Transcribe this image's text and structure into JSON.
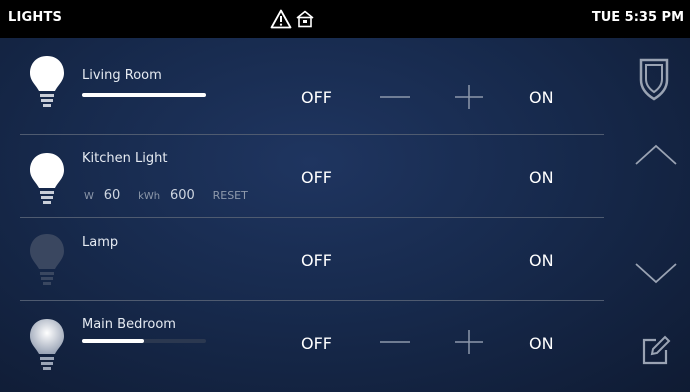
{
  "topbar": {
    "title": "LIGHTS",
    "time": "TUE 5:35 PM",
    "alert_icon": "warning-icon",
    "home_icon": "home-alert-icon"
  },
  "rows": [
    {
      "name": "Living Room",
      "off_label": "OFF",
      "on_label": "ON",
      "bulb": "bright",
      "level": 1.0,
      "has_dimmer": true
    },
    {
      "name": "Kitchen Light",
      "off_label": "OFF",
      "on_label": "ON",
      "bulb": "bright",
      "energy": {
        "w_label": "W",
        "w_value": "60",
        "kwh_label": "kWh",
        "kwh_value": "600",
        "reset_label": "RESET"
      }
    },
    {
      "name": "Lamp",
      "off_label": "OFF",
      "on_label": "ON",
      "bulb": "off"
    },
    {
      "name": "Main Bedroom",
      "off_label": "OFF",
      "on_label": "ON",
      "bulb": "dim",
      "level": 0.5,
      "has_dimmer": true
    }
  ],
  "sidebar": {
    "icons": [
      "shield-icon",
      "chevron-up-icon",
      "chevron-down-icon",
      "edit-icon"
    ]
  },
  "colors": {
    "background": "#14203a",
    "topbar": "#000000",
    "divider": "#4f5b70",
    "bulb_on": "#ffffff",
    "bulb_off": "#3a4760"
  }
}
